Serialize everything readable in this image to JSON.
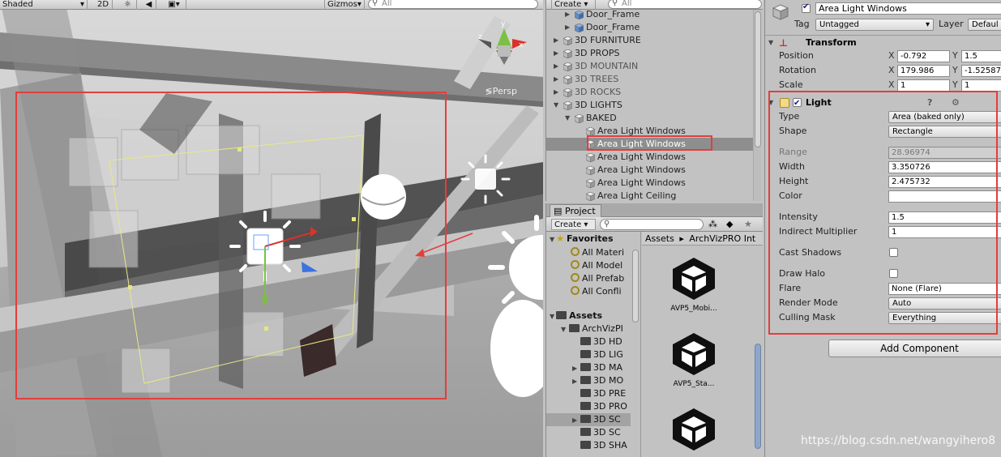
{
  "scene": {
    "shading_mode": "Shaded",
    "mode_2d": "2D",
    "gizmos_label": "Gizmos",
    "search_placeholder": "All",
    "projection_label": "Persp"
  },
  "hierarchy": {
    "create_label": "Create",
    "search_placeholder": "All",
    "rows": [
      {
        "label": "Door_Frame",
        "indent": 3,
        "expander": "collapsed",
        "icon": "prefab-cube-icon",
        "dim": false,
        "selected": false
      },
      {
        "label": "Door_Frame",
        "indent": 3,
        "expander": "collapsed",
        "icon": "prefab-cube-icon",
        "dim": false,
        "selected": false
      },
      {
        "label": "3D FURNITURE",
        "indent": 2,
        "expander": "collapsed",
        "icon": "gameobject-cube-icon",
        "dim": false,
        "selected": false
      },
      {
        "label": "3D PROPS",
        "indent": 2,
        "expander": "collapsed",
        "icon": "gameobject-cube-icon",
        "dim": false,
        "selected": false
      },
      {
        "label": "3D MOUNTAIN",
        "indent": 2,
        "expander": "collapsed",
        "icon": "gameobject-cube-icon",
        "dim": true,
        "selected": false
      },
      {
        "label": "3D TREES",
        "indent": 2,
        "expander": "collapsed",
        "icon": "gameobject-cube-icon",
        "dim": true,
        "selected": false
      },
      {
        "label": "3D ROCKS",
        "indent": 2,
        "expander": "collapsed",
        "icon": "gameobject-cube-icon",
        "dim": true,
        "selected": false
      },
      {
        "label": "3D LIGHTS",
        "indent": 2,
        "expander": "expanded",
        "icon": "gameobject-cube-icon",
        "dim": false,
        "selected": false
      },
      {
        "label": "BAKED",
        "indent": 3,
        "expander": "expanded",
        "icon": "gameobject-cube-icon",
        "dim": false,
        "selected": false
      },
      {
        "label": "Area Light Windows",
        "indent": 4,
        "expander": "none",
        "icon": "gameobject-cube-icon",
        "dim": false,
        "selected": false
      },
      {
        "label": "Area Light Windows",
        "indent": 4,
        "expander": "none",
        "icon": "gameobject-cube-icon",
        "dim": false,
        "selected": true
      },
      {
        "label": "Area Light Windows",
        "indent": 4,
        "expander": "none",
        "icon": "gameobject-cube-icon",
        "dim": false,
        "selected": false
      },
      {
        "label": "Area Light Windows",
        "indent": 4,
        "expander": "none",
        "icon": "gameobject-cube-icon",
        "dim": false,
        "selected": false
      },
      {
        "label": "Area Light Windows",
        "indent": 4,
        "expander": "none",
        "icon": "gameobject-cube-icon",
        "dim": false,
        "selected": false
      },
      {
        "label": "Area Light Ceiling",
        "indent": 4,
        "expander": "none",
        "icon": "gameobject-cube-icon",
        "dim": false,
        "selected": false
      }
    ]
  },
  "project": {
    "tab_label": "Project",
    "create_label": "Create",
    "breadcrumb": [
      "Assets",
      "ArchVizPRO Int"
    ],
    "favorites": {
      "title": "Favorites",
      "items": [
        "All Materi",
        "All Model",
        "All Prefab",
        "All Confli"
      ]
    },
    "assets_tree": {
      "title": "Assets",
      "items": [
        {
          "label": "ArchVizPI",
          "depth": 1,
          "expander": "expanded"
        },
        {
          "label": "3D HD",
          "depth": 2,
          "expander": "none"
        },
        {
          "label": "3D LIG",
          "depth": 2,
          "expander": "none"
        },
        {
          "label": "3D MA",
          "depth": 2,
          "expander": "collapsed"
        },
        {
          "label": "3D MO",
          "depth": 2,
          "expander": "collapsed"
        },
        {
          "label": "3D PRE",
          "depth": 2,
          "expander": "none"
        },
        {
          "label": "3D PRO",
          "depth": 2,
          "expander": "none"
        },
        {
          "label": "3D SC",
          "depth": 2,
          "expander": "collapsed",
          "selected": true
        },
        {
          "label": "3D SC",
          "depth": 2,
          "expander": "none"
        },
        {
          "label": "3D SHA",
          "depth": 2,
          "expander": "none"
        }
      ]
    },
    "assets": [
      {
        "label": "AVP5_Mobi...",
        "icon": "unity-logo-icon"
      },
      {
        "label": "AVP5_Sta...",
        "icon": "unity-logo-icon"
      },
      {
        "label": "",
        "icon": "unity-logo-icon"
      }
    ]
  },
  "inspector": {
    "object_active": true,
    "object_name": "Area Light Windows",
    "tag_label": "Tag",
    "tag_value": "Untagged",
    "layer_label": "Layer",
    "layer_value": "Defaul",
    "transform": {
      "title": "Transform",
      "position": {
        "label": "Position",
        "x": "-0.792",
        "y": "1.5"
      },
      "rotation": {
        "label": "Rotation",
        "x": "179.986",
        "y": "-1.52587"
      },
      "scale": {
        "label": "Scale",
        "x": "1",
        "y": "1"
      },
      "axis_x": "X",
      "axis_y": "Y"
    },
    "light": {
      "title": "Light",
      "enabled": true,
      "fields": [
        {
          "label": "Type",
          "kind": "dropdown",
          "value": "Area (baked only)"
        },
        {
          "label": "Shape",
          "kind": "dropdown",
          "value": "Rectangle"
        },
        {
          "label": "Range",
          "kind": "text-disabled",
          "value": "28.96974"
        },
        {
          "label": "Width",
          "kind": "text",
          "value": "3.350726"
        },
        {
          "label": "Height",
          "kind": "text",
          "value": "2.475732"
        },
        {
          "label": "Color",
          "kind": "color",
          "value": "#ffffff"
        },
        {
          "label": "Intensity",
          "kind": "text",
          "value": "1.5"
        },
        {
          "label": "Indirect Multiplier",
          "kind": "text",
          "value": "1"
        },
        {
          "label": "Cast Shadows",
          "kind": "checkbox",
          "value": false
        },
        {
          "label": "Draw Halo",
          "kind": "checkbox",
          "value": false
        },
        {
          "label": "Flare",
          "kind": "text",
          "value": "None (Flare)"
        },
        {
          "label": "Render Mode",
          "kind": "dropdown",
          "value": "Auto"
        },
        {
          "label": "Culling Mask",
          "kind": "dropdown",
          "value": "Everything"
        }
      ]
    },
    "add_component_label": "Add Component"
  },
  "watermark": "https://blog.csdn.net/wangyihero8",
  "colors": {
    "highlight_box": "#e43d3d",
    "panel_bg": "#c2c2c2",
    "selection_bg": "#8e8e8e"
  }
}
